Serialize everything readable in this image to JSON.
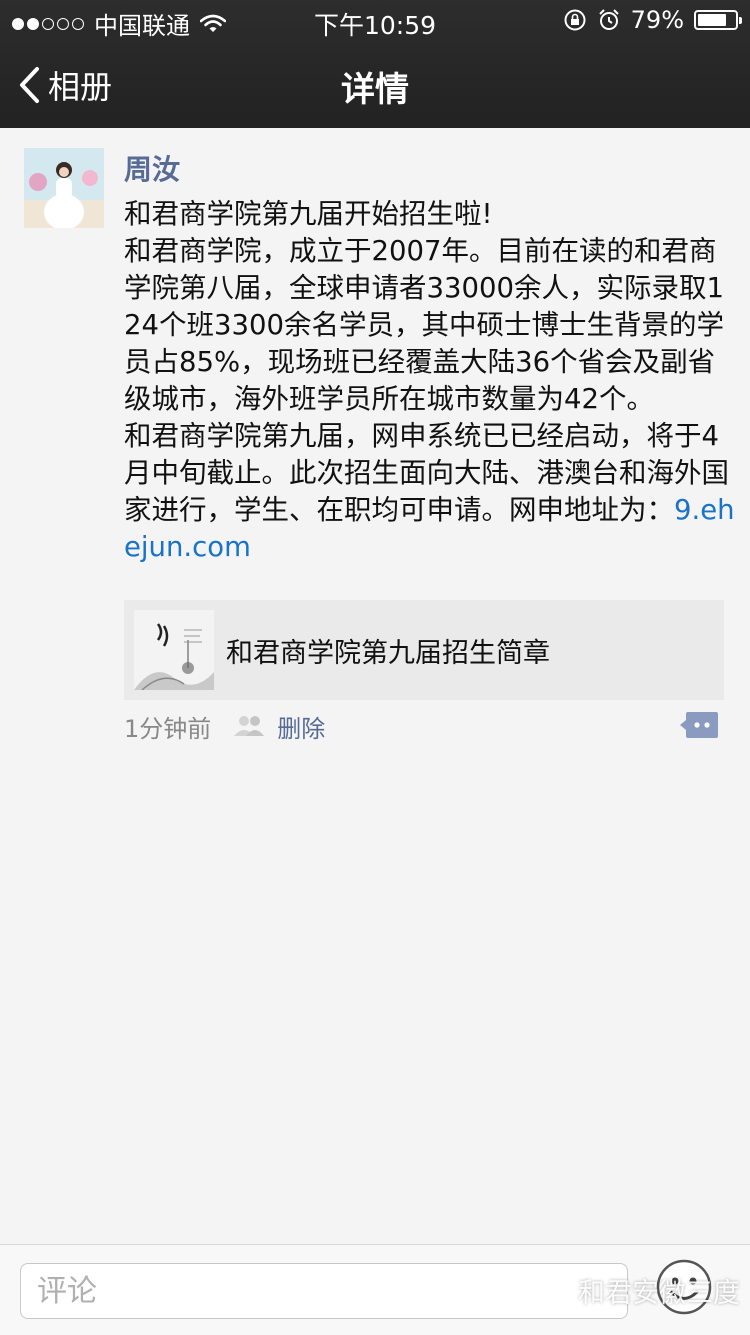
{
  "status_bar": {
    "signal_strength": 2,
    "carrier": "中国联通",
    "time": "下午10:59",
    "battery_percent": "79%",
    "battery_level": 0.79
  },
  "nav": {
    "back_label": "相册",
    "title": "详情"
  },
  "post": {
    "author": "周汝",
    "text": "和君商学院第九届开始招生啦!\n和君商学院，成立于2007年。目前在读的和君商学院第八届，全球申请者33000余人，实际录取124个班3300余名学员，其中硕士博士生背景的学员占85%，现场班已经覆盖大陆36个省会及副省级城市，海外班学员所在城市数量为42个。\n和君商学院第九届，网申系统已已经启动，将于4月中旬截止。此次招生面向大陆、港澳台和海外国家进行，学生、在职均可申请。网申地址为：",
    "link_text": "9.ehejun.com",
    "share_card": {
      "title": "和君商学院第九届招生简章"
    },
    "time_ago": "1分钟前",
    "delete_label": "删除"
  },
  "comment_bar": {
    "placeholder": "评论"
  },
  "watermark": {
    "text": "和君安徽三度"
  },
  "colors": {
    "header_bg": "#262626",
    "link_blue": "#576b95",
    "url_blue": "#1a73c9",
    "page_bg": "#f4f4f5"
  }
}
